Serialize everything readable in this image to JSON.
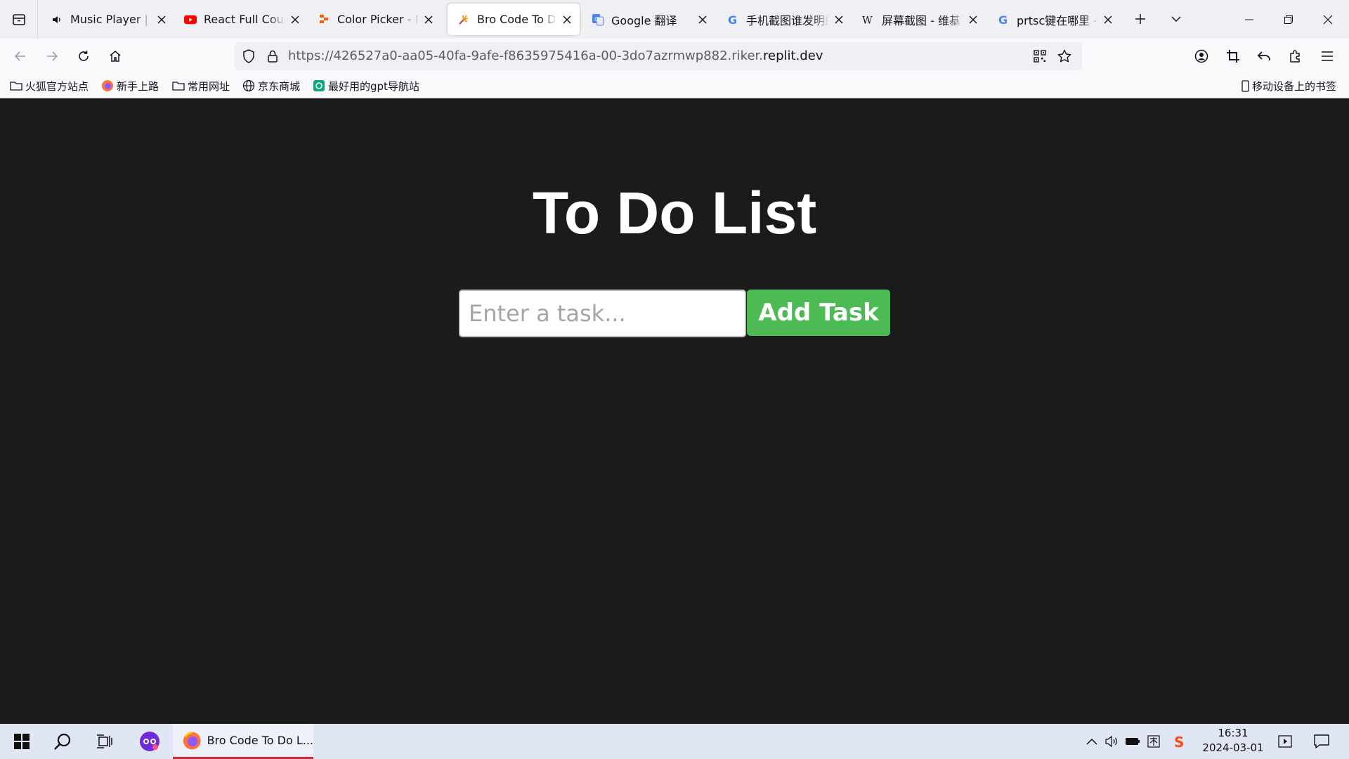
{
  "tabs": [
    {
      "title": "Music Player | Code",
      "favicon": "speaker-icon",
      "active": false
    },
    {
      "title": "React Full Course for free",
      "favicon": "youtube-icon",
      "active": false
    },
    {
      "title": "Color Picker - Replit",
      "favicon": "replit-icon",
      "active": false
    },
    {
      "title": "Bro Code To Do List",
      "favicon": "firework-icon",
      "active": true
    },
    {
      "title": "Google 翻译",
      "favicon": "google-translate-icon",
      "active": false
    },
    {
      "title": "手机截图谁发明的",
      "favicon": "google-icon",
      "active": false
    },
    {
      "title": "屏幕截图 - 维基百科",
      "favicon": "wikipedia-icon",
      "active": false
    },
    {
      "title": "prtsc键在哪里 - Google",
      "favicon": "google-icon",
      "active": false
    }
  ],
  "address": {
    "prefix": "https://426527a0-aa05-40fa-9afe-f8635975416a-00-3do7azrmwp882.riker.",
    "domain": "replit.dev"
  },
  "bookmarks": [
    {
      "label": "火狐官方站点",
      "icon": "folder-icon"
    },
    {
      "label": "新手上路",
      "icon": "firefox-icon"
    },
    {
      "label": "常用网址",
      "icon": "folder-icon"
    },
    {
      "label": "京东商城",
      "icon": "globe-icon"
    },
    {
      "label": "最好用的gpt导航站",
      "icon": "gpt-icon"
    }
  ],
  "mobile_bookmarks": "移动设备上的书签",
  "page": {
    "title": "To Do List",
    "input_placeholder": "Enter a task...",
    "input_value": "",
    "add_button": "Add Task"
  },
  "taskbar": {
    "active_app": "Bro Code To Do L...",
    "time": "16:31",
    "date": "2024-03-01"
  },
  "colors": {
    "page_bg": "#1b1b1b",
    "add_button": "#4dbb53",
    "tab_strip": "#f0f0f4",
    "taskbar": "#e1e6f4"
  }
}
